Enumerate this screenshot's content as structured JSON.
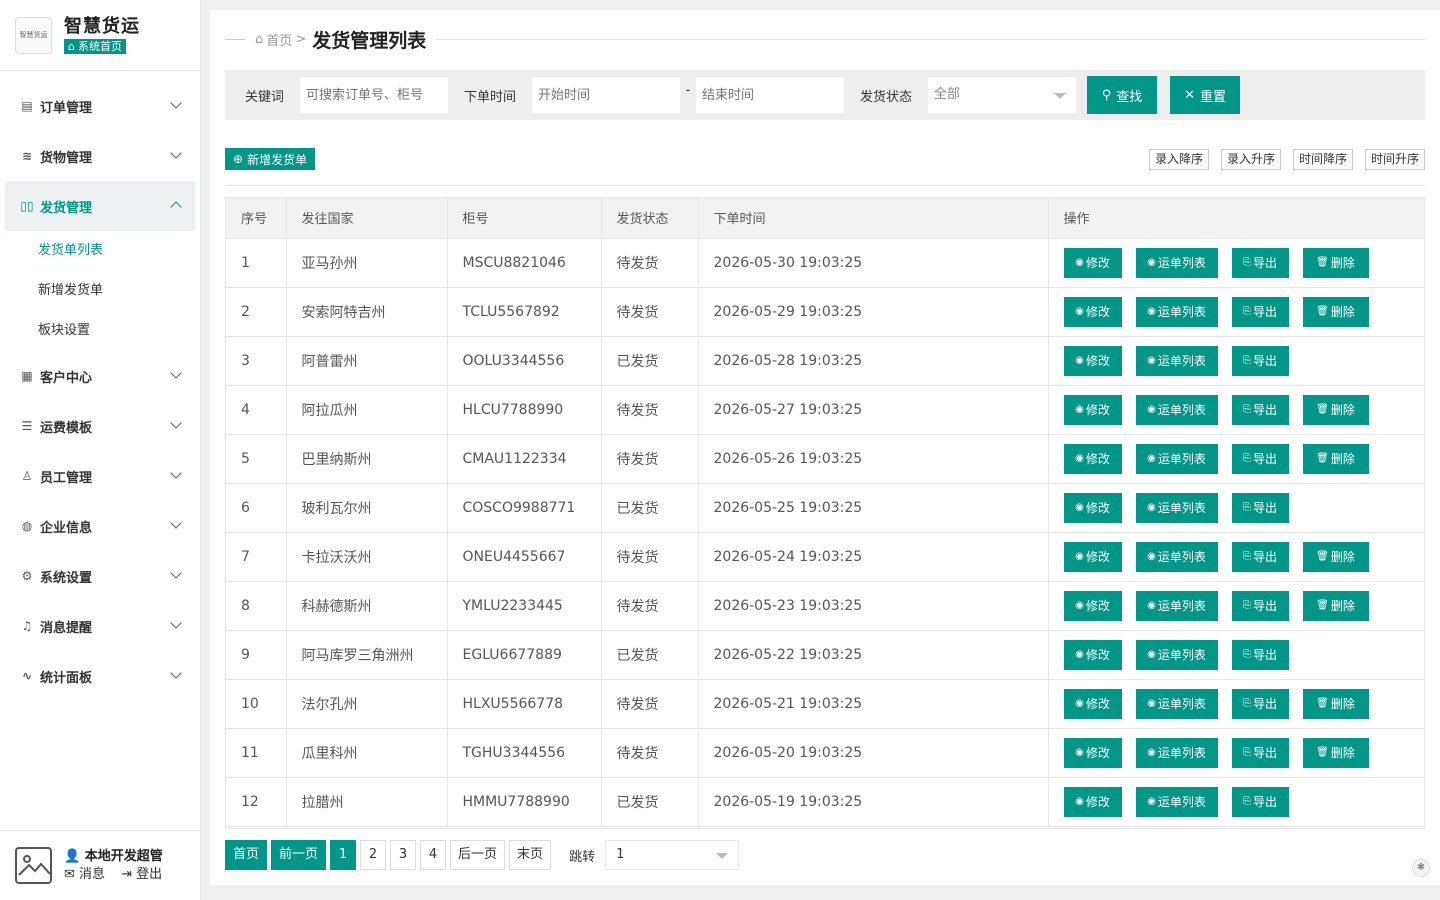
{
  "brand": {
    "logo_text": "智慧货运",
    "title": "智慧货运",
    "home_label": "系统首页"
  },
  "sidebar": {
    "items": [
      {
        "label": "订单管理",
        "icon": "file-icon"
      },
      {
        "label": "货物管理",
        "icon": "layers-icon"
      },
      {
        "label": "发货管理",
        "icon": "book-icon",
        "active": true
      },
      {
        "label": "客户中心",
        "icon": "grid-icon"
      },
      {
        "label": "运费模板",
        "icon": "sliders-icon"
      },
      {
        "label": "员工管理",
        "icon": "user-icon"
      },
      {
        "label": "企业信息",
        "icon": "globe-icon"
      },
      {
        "label": "系统设置",
        "icon": "gear-icon"
      },
      {
        "label": "消息提醒",
        "icon": "bell-icon"
      },
      {
        "label": "统计面板",
        "icon": "pulse-icon"
      }
    ],
    "sub_items": [
      {
        "label": "发货单列表",
        "active": true
      },
      {
        "label": "新增发货单"
      },
      {
        "label": "板块设置"
      }
    ]
  },
  "user": {
    "name": "本地开发超管",
    "message_label": "消息",
    "logout_label": "登出"
  },
  "header": {
    "breadcrumb_home": "首页",
    "breadcrumb_sep": ">",
    "title": "发货管理列表"
  },
  "search": {
    "keyword_label": "关键词",
    "keyword_placeholder": "可搜索订单号、柜号",
    "time_label": "下单时间",
    "start_placeholder": "开始时间",
    "dash": "-",
    "end_placeholder": "结束时间",
    "status_label": "发货状态",
    "status_value": "全部",
    "search_button": "查找",
    "reset_button": "重置"
  },
  "toolbar": {
    "add_button": "新增发货单",
    "sort_buttons": [
      "录入降序",
      "录入升序",
      "时间降序",
      "时间升序"
    ]
  },
  "table": {
    "headers": [
      "序号",
      "发往国家",
      "柜号",
      "发货状态",
      "下单时间",
      "操作"
    ],
    "op_labels": {
      "edit": "修改",
      "waybill": "运单列表",
      "export": "导出",
      "delete": "删除"
    },
    "rows": [
      {
        "no": "1",
        "country": "亚马孙州",
        "container": "MSCU8821046",
        "status": "待发货",
        "time": "2026-05-30 19:03:25",
        "deletable": true
      },
      {
        "no": "2",
        "country": "安索阿特吉州",
        "container": "TCLU5567892",
        "status": "待发货",
        "time": "2026-05-29 19:03:25",
        "deletable": true
      },
      {
        "no": "3",
        "country": "阿普雷州",
        "container": "OOLU3344556",
        "status": "已发货",
        "time": "2026-05-28 19:03:25",
        "deletable": false
      },
      {
        "no": "4",
        "country": "阿拉瓜州",
        "container": "HLCU7788990",
        "status": "待发货",
        "time": "2026-05-27 19:03:25",
        "deletable": true
      },
      {
        "no": "5",
        "country": "巴里纳斯州",
        "container": "CMAU1122334",
        "status": "待发货",
        "time": "2026-05-26 19:03:25",
        "deletable": true
      },
      {
        "no": "6",
        "country": "玻利瓦尔州",
        "container": "COSCO9988771",
        "status": "已发货",
        "time": "2026-05-25 19:03:25",
        "deletable": false
      },
      {
        "no": "7",
        "country": "卡拉沃沃州",
        "container": "ONEU4455667",
        "status": "待发货",
        "time": "2026-05-24 19:03:25",
        "deletable": true
      },
      {
        "no": "8",
        "country": "科赫德斯州",
        "container": "YMLU2233445",
        "status": "待发货",
        "time": "2026-05-23 19:03:25",
        "deletable": true
      },
      {
        "no": "9",
        "country": "阿马库罗三角洲州",
        "container": "EGLU6677889",
        "status": "已发货",
        "time": "2026-05-22 19:03:25",
        "deletable": false
      },
      {
        "no": "10",
        "country": "法尔孔州",
        "container": "HLXU5566778",
        "status": "待发货",
        "time": "2026-05-21 19:03:25",
        "deletable": true
      },
      {
        "no": "11",
        "country": "瓜里科州",
        "container": "TGHU3344556",
        "status": "待发货",
        "time": "2026-05-20 19:03:25",
        "deletable": true
      },
      {
        "no": "12",
        "country": "拉腊州",
        "container": "HMMU7788990",
        "status": "已发货",
        "time": "2026-05-19 19:03:25",
        "deletable": false
      }
    ]
  },
  "pager": {
    "first": "首页",
    "prev": "前一页",
    "pages": [
      "1",
      "2",
      "3",
      "4"
    ],
    "current": "1",
    "next": "后一页",
    "last": "末页",
    "jump_label": "跳转",
    "jump_value": "1"
  },
  "colors": {
    "accent": "#009688"
  }
}
